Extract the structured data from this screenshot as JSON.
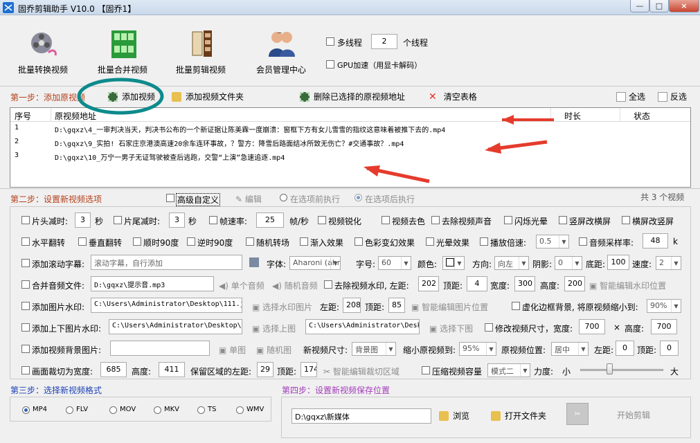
{
  "window": {
    "title": "固乔剪辑助手 V10.0  【固乔1】",
    "controls": [
      "—",
      "□",
      "×"
    ]
  },
  "toolbar": {
    "items": [
      {
        "label": "批量转换视频",
        "icon": "film-reel-icon"
      },
      {
        "label": "批量合并视频",
        "icon": "film-merge-icon"
      },
      {
        "label": "批量剪辑视频",
        "icon": "clapper-icon"
      },
      {
        "label": "会员管理中心",
        "icon": "users-icon"
      }
    ],
    "multithread_label": "多线程",
    "thread_count": "2",
    "thread_unit": "个线程",
    "gpu_label": "GPU加速（用显卡解码）"
  },
  "step1": {
    "label": "第一步：添加原视频",
    "add_video": "添加视频",
    "add_folder": "添加视频文件夹",
    "delete_selected": "删除已选择的原视频地址",
    "clear_table": "清空表格",
    "select_all": "全选",
    "invert": "反选",
    "table": {
      "headers": [
        "序号",
        "原视频地址",
        "时长",
        "状态"
      ],
      "rows": [
        {
          "no": "1",
          "path": "D:\\gqxz\\4_一审判决当天，判决书公布的一个新证据让陈美霖一度崩溃：窗框下方有女儿雪雪的指纹这意味着被推下去的.mp4"
        },
        {
          "no": "2",
          "path": "D:\\gqxz\\9_实拍! 石家庄京港澳高速20余车连环事故，？警方：降雪后路面结冰所致无伤亡？#交通事故？.mp4"
        },
        {
          "no": "3",
          "path": "D:\\gqxz\\10_万宁一男子无证驾驶被查后逃跑，交警“上演”急速追逐.mp4"
        }
      ]
    },
    "count_text": "共 3 个视频"
  },
  "step2": {
    "label": "第二步：设置新视频选项",
    "advanced_custom": "高级自定义",
    "edit": "编辑",
    "before_option": "在选项前执行",
    "after_option": "在选项后执行",
    "row1": {
      "head_cut": "片头减时:",
      "head_val": "3",
      "sec1": "秒",
      "tail_cut": "片尾减时:",
      "tail_val": "3",
      "sec2": "秒",
      "frame_rate": "帧速率:",
      "frame_val": "25",
      "fps_unit": "帧/秒",
      "sharpen": "视频锐化",
      "desaturate": "视频去色",
      "remove_audio": "去除视频声音",
      "flash": "闪烁光晕",
      "v2h": "竖屏改横屏",
      "h2v": "横屏改竖屏"
    },
    "row2": {
      "hflip": "水平翻转",
      "vflip": "垂直翻转",
      "cw90": "顺时90度",
      "ccw90": "逆时90度",
      "random_rotate": "随机转场",
      "fade_in": "渐入效果",
      "color_shift": "色彩变幻效果",
      "halo": "光晕效果",
      "speed": "播放倍速:",
      "speed_val": "0.5",
      "sample_rate": "音频采样率:",
      "sample_val": "48",
      "sample_unit": "k"
    },
    "row3": {
      "scroll_caption": "添加滚动字幕:",
      "scroll_placeholder": "滚动字幕，自行添加",
      "font": "字体:",
      "font_val": "Aharoni (ahr…",
      "size": "字号:",
      "size_val": "60",
      "color": "颜色:",
      "direction": "方向:",
      "direction_val": "向左",
      "shadow": "阴影:",
      "shadow_val": "0",
      "bottom": "底距:",
      "bottom_val": "100",
      "speed": "速度:",
      "speed_val": "2"
    },
    "row4": {
      "merge_audio": "合并音频文件:",
      "audio_path": "D:\\gqxz\\提示音.mp3",
      "single_audio": "单个音频",
      "random_audio": "随机音频",
      "remove_watermark": "去除视频水印, 左距:",
      "left_val": "202",
      "top": "顶距:",
      "top_val": "4",
      "width": "宽度:",
      "width_val": "300",
      "height": "高度:",
      "height_val": "200",
      "smart_wm": "智能编辑水印位置"
    },
    "row5": {
      "image_watermark": "添加图片水印:",
      "image_path": "C:\\Users\\Administrator\\Desktop\\111.j",
      "select_image": "选择水印图片",
      "left": "左距:",
      "left_val": "208",
      "top": "顶距:",
      "top_val": "85",
      "smart_image": "智能编辑图片位置",
      "blur_border": "虚化边框背景, 将原视频缩小到:",
      "blur_val": "90%"
    },
    "row6": {
      "top_bottom_image": "添加上下图片水印:",
      "top_path": "C:\\Users\\Administrator\\Desktop\\i",
      "select_top": "选择上图",
      "bottom_path": "C:\\Users\\Administrator\\Desk",
      "select_bottom": "选择下图",
      "resize": "修改视频尺寸，宽度:",
      "resize_w": "700",
      "times": "×",
      "resize_h_label": "高度:",
      "resize_h": "700"
    },
    "row7": {
      "bg_image": "添加视频背景图片:",
      "single_image": "单图",
      "random_image": "随机图",
      "new_size": "新视频尺寸:",
      "new_size_val": "背景图",
      "shrink": "缩小原视频到:",
      "shrink_val": "95%",
      "position": "原视频位置:",
      "position_val": "居中",
      "left": "左距:",
      "left_val": "0",
      "top": "顶距:",
      "top_val": "0"
    },
    "row8": {
      "crop_width": "画面裁切为宽度:",
      "crop_w": "685",
      "height": "高度:",
      "crop_h": "411",
      "keep_left": "保留区域的左距:",
      "keep_left_val": "29",
      "top": "顶距:",
      "top_val": "174",
      "smart_crop": "智能编辑裁切区域",
      "compress": "压缩视频容量",
      "mode_val": "模式二",
      "strength": "力度:",
      "small": "小",
      "large": "大",
      "strength_level": 0.35
    }
  },
  "step3": {
    "label": "第三步：选择新视频格式",
    "formats": [
      "MP4",
      "FLV",
      "MOV",
      "MKV",
      "TS",
      "WMV"
    ],
    "selected": "MP4"
  },
  "step4": {
    "label": "第四步：设置新视频保存位置",
    "path": "D:\\gqxz\\新媒体",
    "browse": "浏览",
    "open_folder": "打开文件夹",
    "start": "开始剪辑"
  },
  "colors": {
    "annotation": "#0e8a8c",
    "arrow": "#e53b2c",
    "step_label": "#b4401a",
    "step_blue": "#1a3fb4",
    "step_purple": "#a23bb8"
  }
}
